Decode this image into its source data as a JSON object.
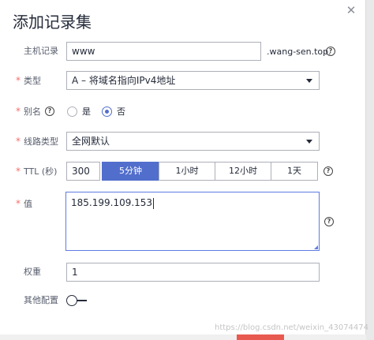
{
  "dialog": {
    "title": "添加记录集",
    "close_glyph": "✕"
  },
  "form": {
    "host": {
      "label": "主机记录",
      "value": "www",
      "suffix": ".wang-sen.top."
    },
    "type": {
      "label": "类型",
      "value": "A – 将域名指向IPv4地址"
    },
    "alias": {
      "label": "别名",
      "options": [
        "是",
        "否"
      ],
      "selected": "否"
    },
    "line": {
      "label": "线路类型",
      "value": "全网默认"
    },
    "ttl": {
      "label": "TTL (秒)",
      "value": "300",
      "presets": [
        "5分钟",
        "1小时",
        "12小时",
        "1天"
      ],
      "selected": "5分钟"
    },
    "record_value": {
      "label": "值",
      "value": "185.199.109.153"
    },
    "weight": {
      "label": "权重",
      "value": "1"
    },
    "other": {
      "label": "其他配置",
      "enabled": false
    }
  },
  "required_mark": "*",
  "help_glyph": "?",
  "colors": {
    "accent": "#526ecc",
    "required": "#f66f6a",
    "focus_border": "#5e7ce0"
  },
  "watermark": "https://blog.csdn.net/weixin_43074474"
}
